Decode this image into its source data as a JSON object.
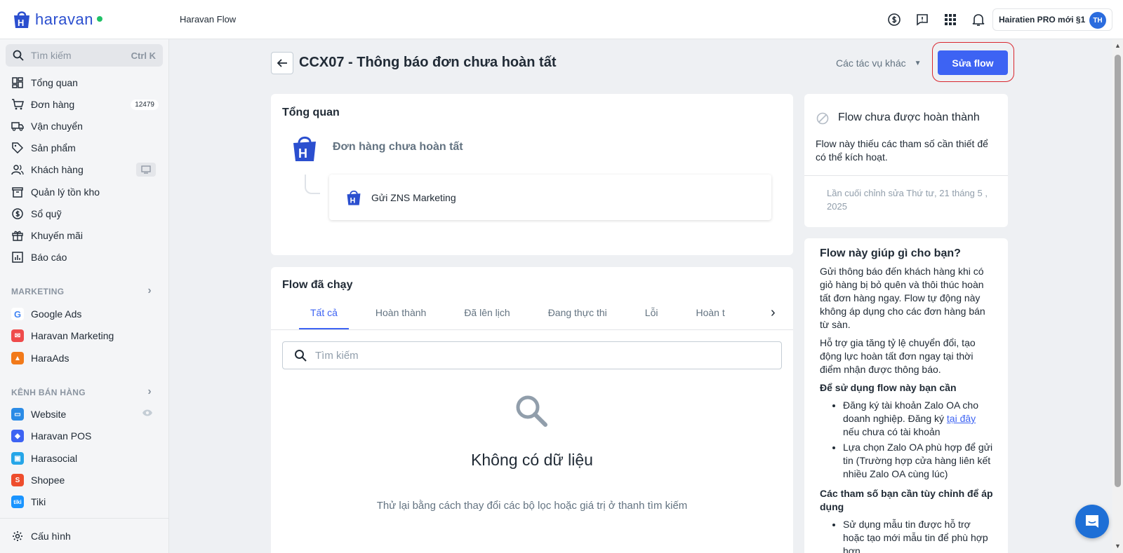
{
  "topbar": {
    "logo_text": "haravan",
    "app_name": "Haravan Flow",
    "store_name": "Hairatien PRO mới §1",
    "avatar_initials": "TH"
  },
  "sidebar": {
    "search_placeholder": "Tìm kiếm",
    "search_shortcut": "Ctrl K",
    "items": [
      {
        "label": "Tổng quan",
        "icon": "dashboard-icon"
      },
      {
        "label": "Đơn hàng",
        "icon": "cart-icon",
        "badge": "12479"
      },
      {
        "label": "Vận chuyển",
        "icon": "truck-icon"
      },
      {
        "label": "Sản phẩm",
        "icon": "tag-icon"
      },
      {
        "label": "Khách hàng",
        "icon": "users-icon"
      },
      {
        "label": "Quản lý tồn kho",
        "icon": "archive-icon"
      },
      {
        "label": "Sổ quỹ",
        "icon": "dollar-icon"
      },
      {
        "label": "Khuyến mãi",
        "icon": "gift-icon"
      },
      {
        "label": "Báo cáo",
        "icon": "report-icon"
      }
    ],
    "marketing_title": "MARKETING",
    "marketing_items": [
      {
        "label": "Google Ads"
      },
      {
        "label": "Haravan Marketing"
      },
      {
        "label": "HaraAds"
      }
    ],
    "channels_title": "KÊNH BÁN HÀNG",
    "channel_items": [
      {
        "label": "Website"
      },
      {
        "label": "Haravan POS"
      },
      {
        "label": "Harasocial"
      },
      {
        "label": "Shopee"
      },
      {
        "label": "Tiki"
      }
    ],
    "settings_label": "Cấu hình"
  },
  "header": {
    "title": "CCX07 - Thông báo đơn chưa hoàn tất",
    "more_actions": "Các tác vụ khác",
    "edit_button": "Sửa flow"
  },
  "overview": {
    "title": "Tổng quan",
    "trigger": "Đơn hàng chưa hoàn tất",
    "action": "Gửi ZNS Marketing"
  },
  "runs": {
    "title": "Flow đã chạy",
    "tabs": [
      "Tất cả",
      "Hoàn thành",
      "Đã lên lịch",
      "Đang thực thi",
      "Lỗi",
      "Hoàn t"
    ],
    "search_placeholder": "Tìm kiếm",
    "empty_title": "Không có dữ liệu",
    "empty_subtitle": "Thử lại bằng cách thay đổi các bộ lọc hoặc giá trị ở thanh tìm kiếm"
  },
  "status": {
    "title": "Flow chưa được hoàn thành",
    "description": "Flow này thiếu các tham số cần thiết để có thể kích hoạt.",
    "last_edited": "Lần cuối chỉnh sửa Thứ tư, 21 tháng 5 , 2025"
  },
  "help": {
    "title": "Flow này giúp gì cho bạn?",
    "p1": "Gửi thông báo đến khách hàng khi có giỏ hàng bị bỏ quên và thôi thúc hoàn tất đơn hàng ngay. Flow tự động này không áp dụng cho các đơn hàng bán từ sàn.",
    "p2": "Hỗ trợ gia tăng tỷ lệ chuyển đổi, tạo động lực hoàn tất đơn ngay tại thời điểm nhận được thông báo.",
    "req_title": "Để sử dụng flow này bạn cần",
    "req1_before": "Đăng ký tài khoản Zalo OA cho doanh nghiệp. Đăng ký ",
    "req1_link": "tại đây",
    "req1_after": " nếu chưa có tài khoản",
    "req2": "Lựa chọn Zalo OA phù hợp để gửi tin (Trường hợp cửa hàng liên kết nhiều Zalo OA cùng lúc)",
    "params_title": "Các tham số bạn cần tùy chỉnh để áp dụng",
    "param1": "Sử dụng mẫu tin được hỗ trợ hoặc tạo mới mẫu tin để phù hợp hơn"
  },
  "colors": {
    "primary": "#3d63f3",
    "highlight_ring": "#d9262e",
    "brand": "#2b4fcf"
  }
}
